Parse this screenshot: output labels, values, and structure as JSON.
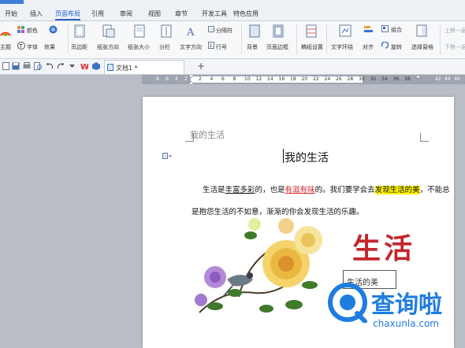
{
  "menu": {
    "items": [
      "开始",
      "插入",
      "页面布局",
      "引用",
      "审阅",
      "视图",
      "章节",
      "开发工具",
      "特色应用"
    ],
    "active_index": 2
  },
  "ribbon": {
    "theme_label": "主题",
    "colors_label": "颜色",
    "font_label": "字体",
    "effects_label": "效果",
    "margins_label": "页边距",
    "orientation_label": "纸张方向",
    "size_label": "纸张大小",
    "columns_label": "分栏",
    "text_direction_label": "文字方向",
    "breaks_label": "分隔符",
    "line_numbers_label": "行号",
    "background_label": "背景",
    "page_border_label": "页面边框",
    "draft_settings_label": "稿纸设置",
    "wrap_text_label": "文字环绕",
    "align_label": "对齐",
    "group_label": "组合",
    "rotate_label": "旋转",
    "selection_pane_label": "选择窗格",
    "bring_forward_label": "上移一层",
    "send_backward_label": "下移一层"
  },
  "doc_tab": {
    "title": "文档1 *"
  },
  "ruler": {
    "left_ticks": [
      "8",
      "6",
      "4",
      "2"
    ],
    "mid_ticks": [
      "2",
      "4",
      "6",
      "8",
      "10",
      "12",
      "14",
      "16",
      "18",
      "20",
      "22",
      "24",
      "26",
      "28",
      "30",
      "32",
      "34",
      "36",
      "38"
    ],
    "right_ticks": [
      "42",
      "44",
      "46"
    ]
  },
  "document": {
    "header_text": "我的生活",
    "title": "我的生活",
    "para_line1_a": "生活是",
    "para_line1_b": "丰富多彩",
    "para_line1_c": "的，也是",
    "para_line1_d": "有滋有味",
    "para_line1_e": "的。我们要学会去",
    "para_line1_f": "发现生活的美",
    "para_line1_g": "，不能总",
    "para_line2": "是抱怨生活的不如意，渐渐的你会发现生活的乐趣。",
    "wordart": "生活",
    "textbox_text": "生活的美"
  },
  "watermark": {
    "text": "查询啦",
    "url": "chaxunla.com"
  },
  "colors": {
    "accent": "#2b62c6",
    "wordart": "#c4252d",
    "highlight": "#fff200",
    "red_text": "#d6262b",
    "watermark_blue": "#1f7de0"
  }
}
